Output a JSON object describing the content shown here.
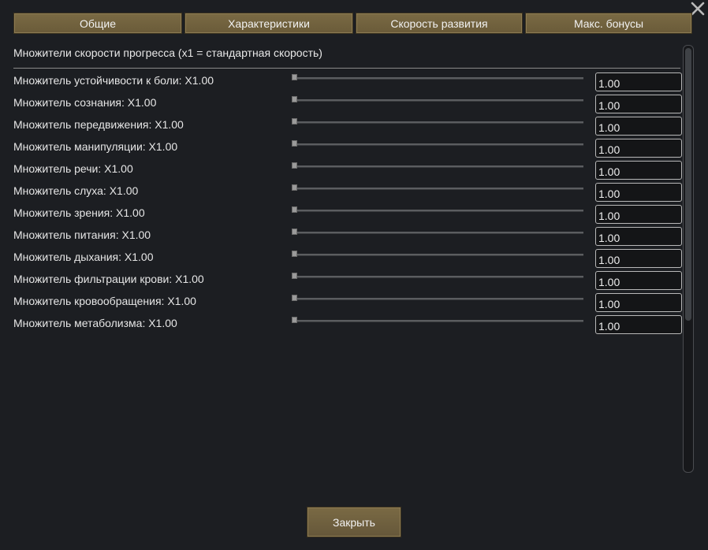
{
  "tabs": [
    {
      "label": "Общие"
    },
    {
      "label": "Характеристики"
    },
    {
      "label": "Скорость развития"
    },
    {
      "label": "Макс. бонусы"
    }
  ],
  "subtitle": "Множители скорости прогресса (x1 = стандартная скорость)",
  "rows": [
    {
      "label": "Множитель устойчивости к боли: X1.00",
      "value": "1.00"
    },
    {
      "label": "Множитель сознания: X1.00",
      "value": "1.00"
    },
    {
      "label": "Множитель передвижения: X1.00",
      "value": "1.00"
    },
    {
      "label": "Множитель манипуляции: X1.00",
      "value": "1.00"
    },
    {
      "label": "Множитель речи: X1.00",
      "value": "1.00"
    },
    {
      "label": "Множитель слуха: X1.00",
      "value": "1.00"
    },
    {
      "label": "Множитель зрения: X1.00",
      "value": "1.00"
    },
    {
      "label": "Множитель питания: X1.00",
      "value": "1.00"
    },
    {
      "label": "Множитель дыхания: X1.00",
      "value": "1.00"
    },
    {
      "label": "Множитель фильтрации крови: X1.00",
      "value": "1.00"
    },
    {
      "label": "Множитель кровообращения: X1.00",
      "value": "1.00"
    },
    {
      "label": "Множитель метаболизма: X1.00",
      "value": "1.00"
    }
  ],
  "slider_level": 0,
  "footer": {
    "close_label": "Закрыть"
  },
  "icons": {
    "close": "close-icon"
  },
  "colors": {
    "tab_bg": "#75663f",
    "panel_bg": "#1c1e22"
  }
}
